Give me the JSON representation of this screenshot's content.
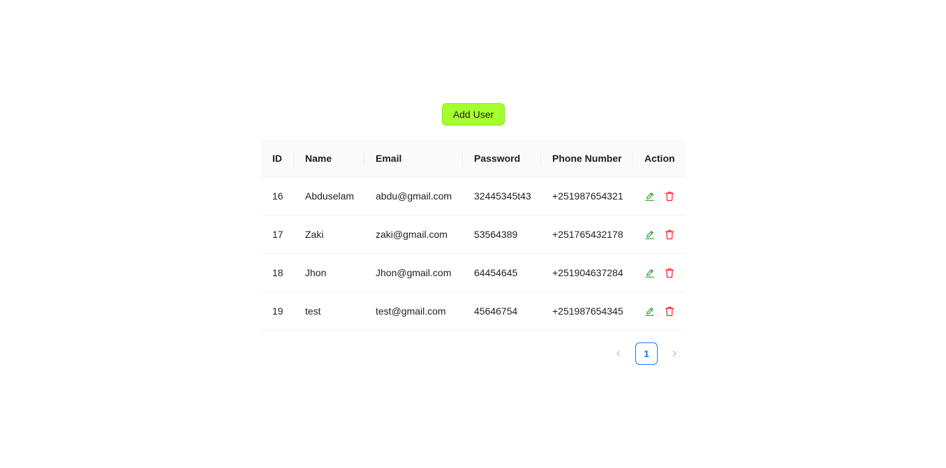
{
  "toolbar": {
    "add_user_label": "Add User"
  },
  "table": {
    "columns": [
      "ID",
      "Name",
      "Email",
      "Password",
      "Phone Number",
      "Action"
    ],
    "rows": [
      {
        "id": "16",
        "name": "Abduselam",
        "email": "abdu@gmail.com",
        "password": "32445345t43",
        "phone": "+251987654321"
      },
      {
        "id": "17",
        "name": "Zaki",
        "email": "zaki@gmail.com",
        "password": "53564389",
        "phone": "+251765432178"
      },
      {
        "id": "18",
        "name": "Jhon",
        "email": "Jhon@gmail.com",
        "password": "64454645",
        "phone": "+251904637284"
      },
      {
        "id": "19",
        "name": "test",
        "email": "test@gmail.com",
        "password": "45646754",
        "phone": "+251987654345"
      }
    ]
  },
  "pagination": {
    "current_page": "1"
  },
  "colors": {
    "add_button": "#a6ff2e",
    "edit_icon": "#2e9e2e",
    "delete_icon": "#ff1f1f",
    "active_page": "#1677ff"
  },
  "icons": {
    "edit": "edit-icon",
    "delete": "delete-icon",
    "prev": "chevron-left-icon",
    "next": "chevron-right-icon"
  }
}
